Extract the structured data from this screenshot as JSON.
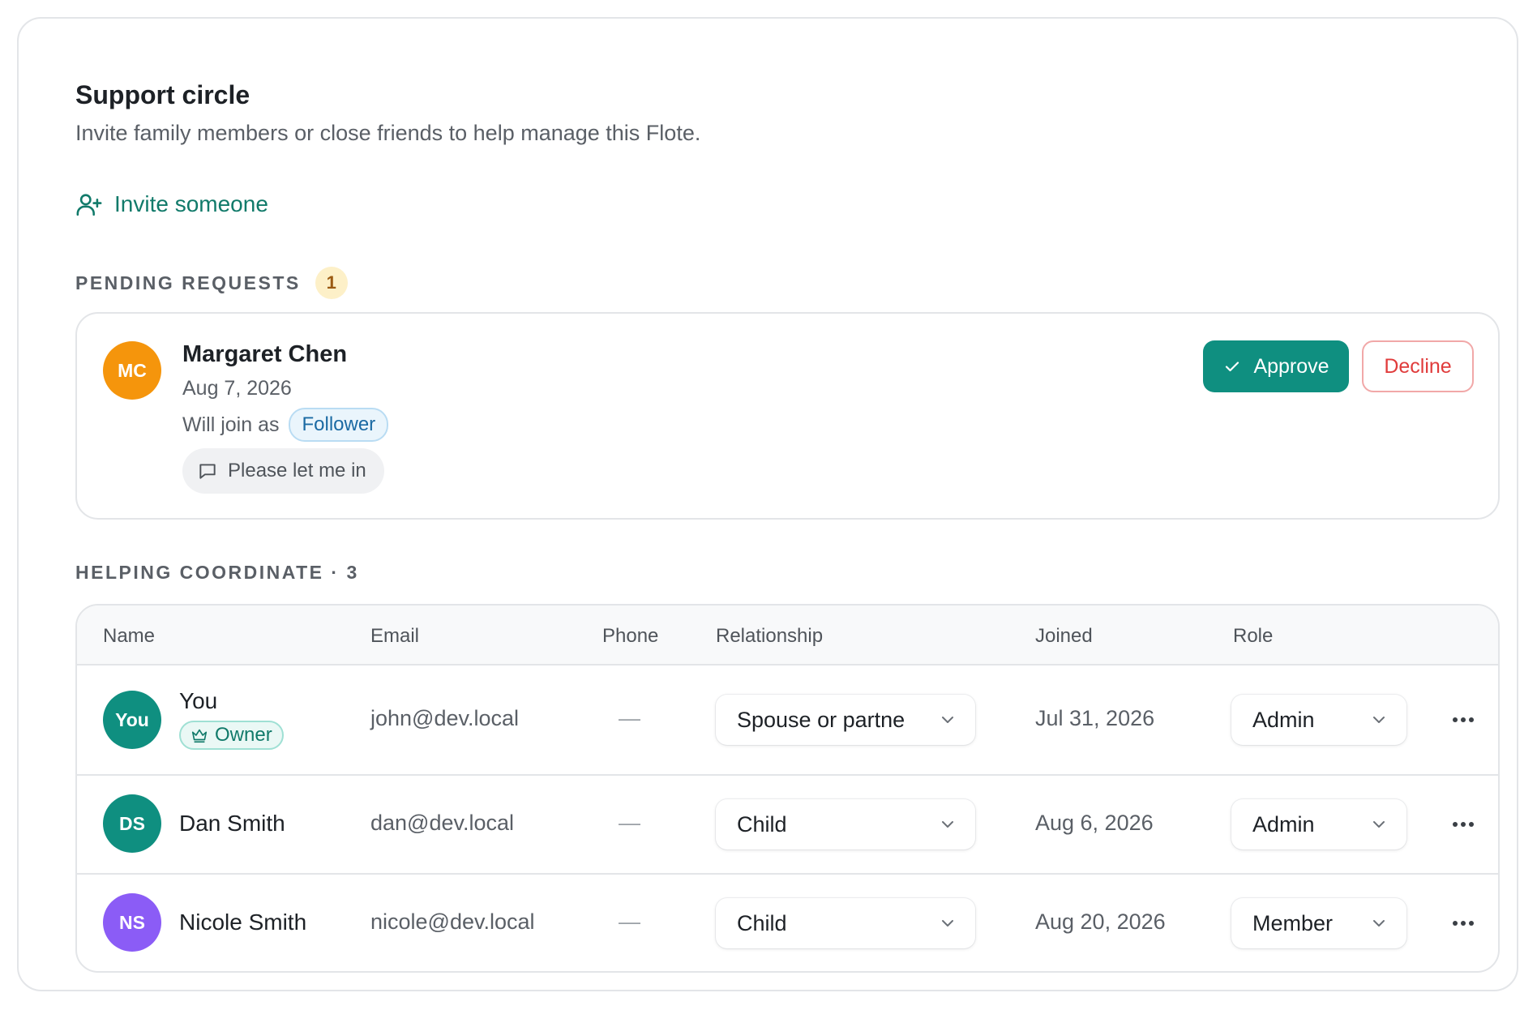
{
  "header": {
    "title": "Support circle",
    "subtitle": "Invite family members or close friends to help manage this Flote.",
    "invite_label": "Invite someone"
  },
  "pending": {
    "label": "PENDING REQUESTS",
    "count": "1",
    "request": {
      "initials": "MC",
      "avatar_color": "#f5950c",
      "name": "Margaret Chen",
      "date": "Aug 7, 2026",
      "join_prefix": "Will join as",
      "join_role": "Follower",
      "message": "Please let me in",
      "approve_label": "Approve",
      "decline_label": "Decline"
    }
  },
  "members": {
    "label": "HELPING COORDINATE · 3",
    "columns": [
      "Name",
      "Email",
      "Phone",
      "Relationship",
      "Joined",
      "Role"
    ],
    "rows": [
      {
        "initials": "You",
        "avatar_color": "#0f8f80",
        "name": "You",
        "owner_badge": "Owner",
        "email": "john@dev.local",
        "phone": "—",
        "relationship": "Spouse or partne",
        "joined": "Jul 31, 2026",
        "role": "Admin"
      },
      {
        "initials": "DS",
        "avatar_color": "#0f8f80",
        "name": "Dan Smith",
        "email": "dan@dev.local",
        "phone": "—",
        "relationship": "Child",
        "joined": "Aug 6, 2026",
        "role": "Admin"
      },
      {
        "initials": "NS",
        "avatar_color": "#8b5cf6",
        "name": "Nicole Smith",
        "email": "nicole@dev.local",
        "phone": "—",
        "relationship": "Child",
        "joined": "Aug 20, 2026",
        "role": "Member"
      }
    ]
  },
  "colors": {
    "accent": "#0f8f80",
    "link": "#117a6a",
    "danger": "#e03b3b"
  },
  "icons": {
    "invite": "user-plus-icon",
    "approve": "check-icon",
    "message": "chat-bubble-icon",
    "owner": "crown-icon",
    "select": "chevron-down-icon",
    "row_actions": "more-horizontal-icon"
  }
}
